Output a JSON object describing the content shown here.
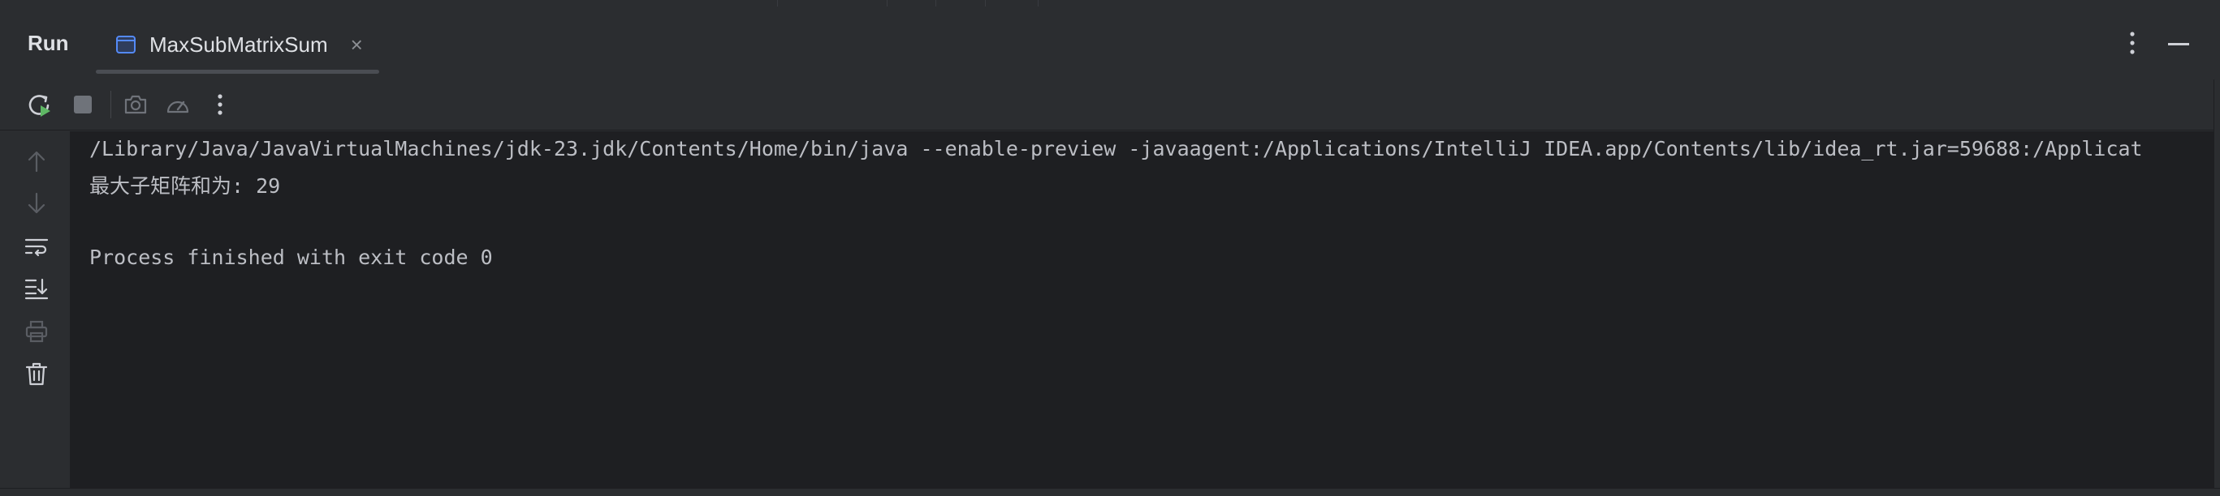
{
  "header": {
    "title": "Run",
    "tab": {
      "label": "MaxSubMatrixSum",
      "close_glyph": "×"
    }
  },
  "icons": {
    "tab": "console-icon",
    "rerun": "rerun-icon",
    "stop": "stop-icon",
    "screenshot": "camera-icon",
    "profile": "speedometer-icon",
    "more": "more-vertical-icon",
    "up": "arrow-up-icon",
    "down": "arrow-down-icon",
    "wrap": "soft-wrap-icon",
    "scroll_end": "scroll-to-end-icon",
    "print": "print-icon",
    "clear": "trash-icon",
    "minimize": "minimize-icon"
  },
  "colors": {
    "panel": "#2b2d30",
    "console_bg": "#1e1f22",
    "text": "#bcbec4",
    "rerun_green": "#5fb865"
  },
  "console": {
    "lines": [
      "/Library/Java/JavaVirtualMachines/jdk-23.jdk/Contents/Home/bin/java --enable-preview -javaagent:/Applications/IntelliJ IDEA.app/Contents/lib/idea_rt.jar=59688:/Applicat",
      "最大子矩阵和为: 29",
      "",
      "Process finished with exit code 0"
    ]
  }
}
